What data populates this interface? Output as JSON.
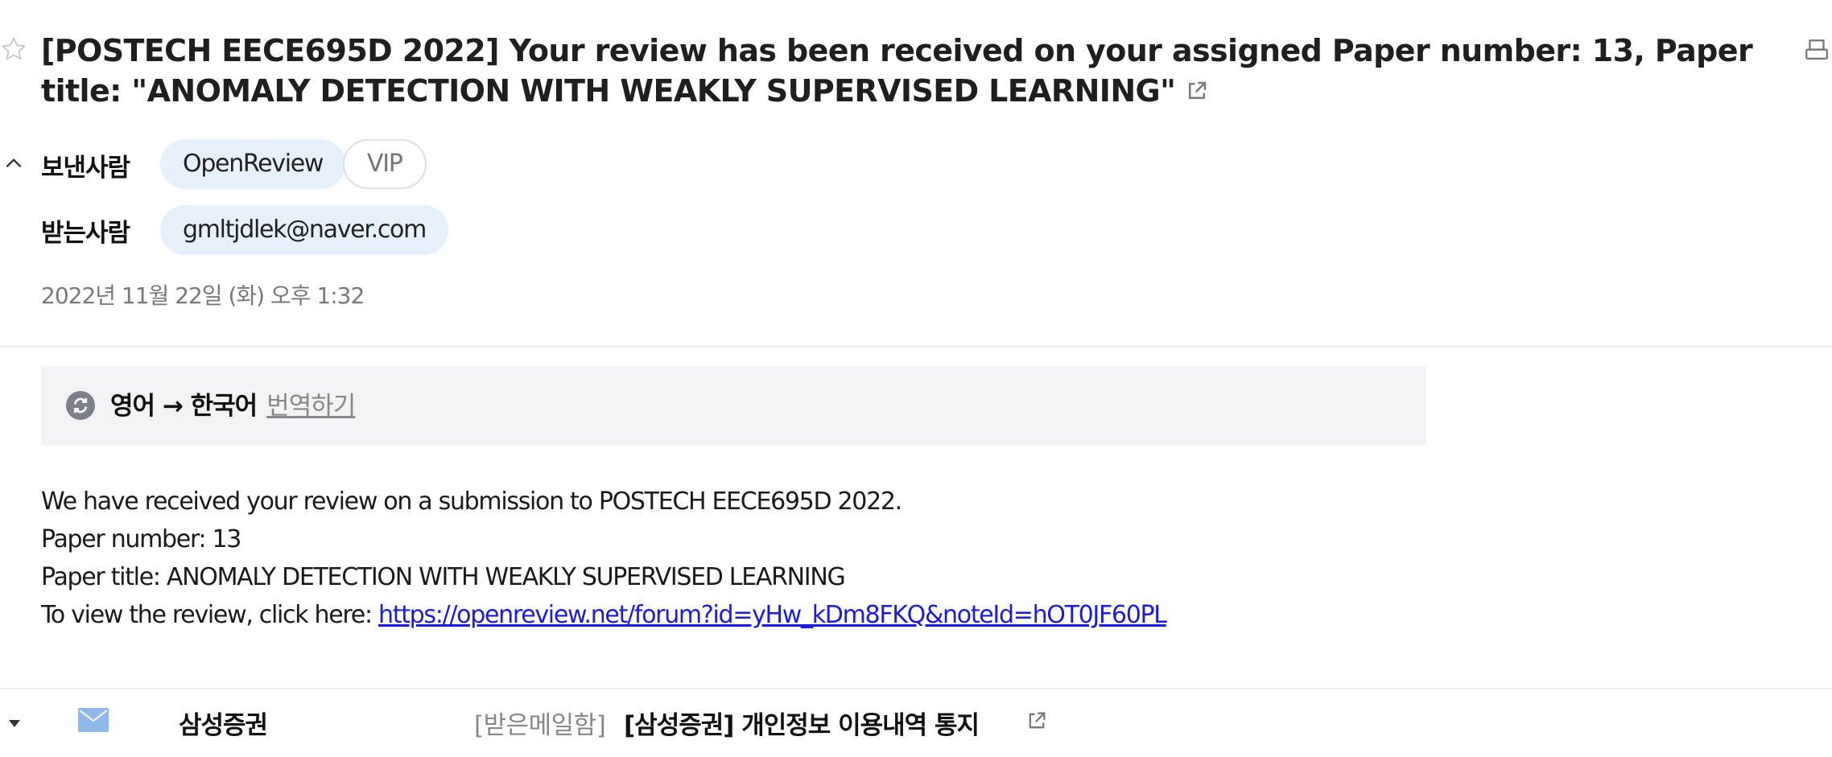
{
  "mail": {
    "subject": "[POSTECH EECE695D 2022] Your review has been received on your assigned Paper number: 13, Paper title: \"ANOMALY DETECTION WITH WEAKLY SUPERVISED LEARNING\"",
    "sender_label": "보낸사람",
    "sender_chip": "OpenReview",
    "vip_chip": "VIP",
    "recipient_label": "받는사람",
    "recipient_chip": "gmltjdlek@naver.com",
    "date": "2022년 11월 22일 (화) 오후 1:32"
  },
  "translate": {
    "languages": "영어 → 한국어",
    "action": "번역하기"
  },
  "body": {
    "line1": "We have received your review on a submission to POSTECH EECE695D 2022.",
    "line2": "Paper number: 13",
    "line3": "Paper title: ANOMALY DETECTION WITH WEAKLY SUPERVISED LEARNING",
    "line4_prefix": "To view the review, click here: ",
    "link": "https://openreview.net/forum?id=yHw_kDm8FKQ&noteId=hOT0JF60PL"
  },
  "next_mail": {
    "sender": "삼성증권",
    "folder": "[받은메일함]",
    "subject": "[삼성증권] 개인정보 이용내역 통지"
  },
  "icons": [
    "star-icon",
    "external-link-icon",
    "print-icon",
    "chevron-up-icon",
    "translate-icon",
    "triangle-down-icon",
    "mail-icon"
  ],
  "colors": {
    "chip_blue": "#e7f1fc",
    "link": "#1a1ae6",
    "mail_icon": "#8fb8ea"
  }
}
